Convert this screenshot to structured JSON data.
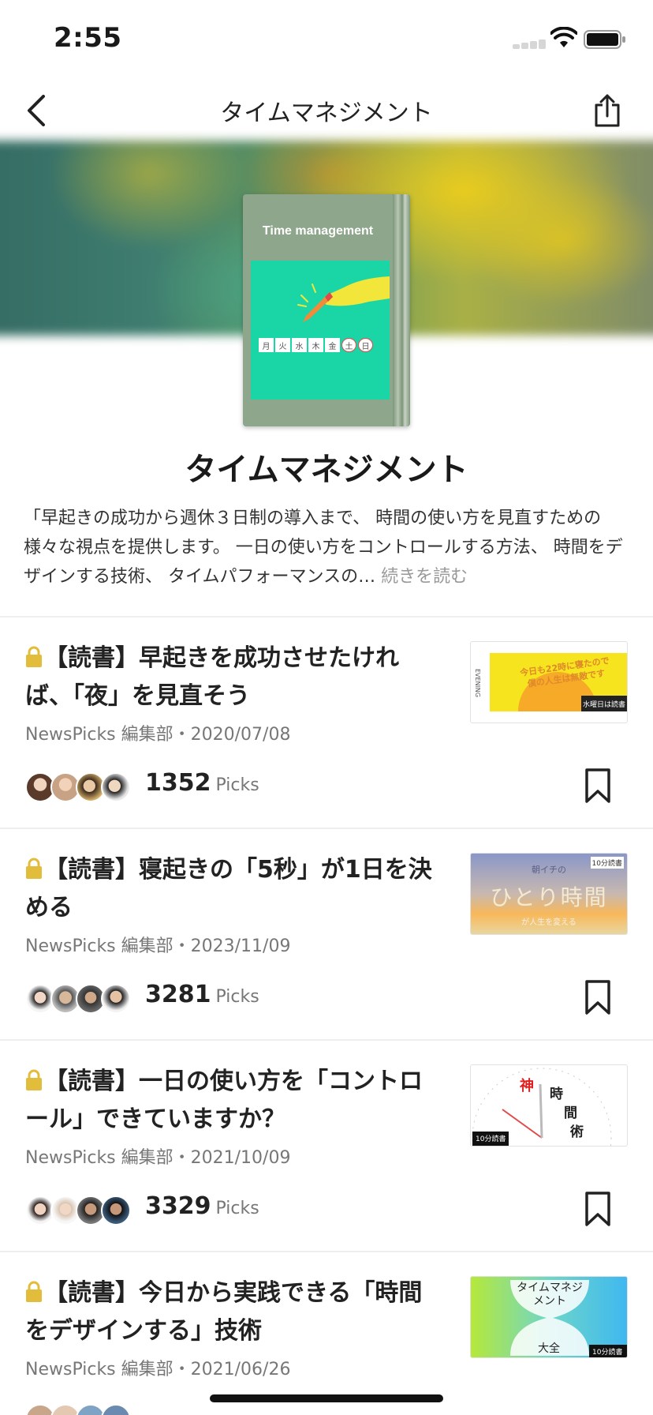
{
  "status_bar": {
    "time": "2:55"
  },
  "nav": {
    "title": "タイムマネジメント"
  },
  "hero": {
    "book_title": "Time management",
    "book_days": [
      "月",
      "火",
      "水",
      "木",
      "金",
      "土",
      "日"
    ]
  },
  "collection": {
    "title": "タイムマネジメント",
    "description": "「早起きの成功から週休３日制の導入まで、 時間の使い方を見直すための様々な視点を提供します。 一日の使い方をコントロールする方法、 時間をデザインする技術、 タイムパフォーマンスの…",
    "read_more": "続きを読む"
  },
  "articles": [
    {
      "title": "【読書】早起きを成功させたければ、「夜」を見直そう",
      "meta": "NewsPicks 編集部・2020/07/08",
      "picks": "1352",
      "picks_label": "Picks",
      "thumb_text": [
        "今日も22時に寝たので",
        "僕の人生は無敵です",
        "EVENING",
        "水曜日は読書"
      ]
    },
    {
      "title": "【読書】寝起きの「5秒」が1日を決める",
      "meta": "NewsPicks 編集部・2023/11/09",
      "picks": "3281",
      "picks_label": "Picks",
      "thumb_text": [
        "朝イチの",
        "ひとり時間",
        "が人生を変える",
        "10分読書"
      ]
    },
    {
      "title": "【読書】一日の使い方を「コントロール」できていますか？",
      "meta": "NewsPicks 編集部・2021/10/09",
      "picks": "3329",
      "picks_label": "Picks",
      "thumb_text": [
        "神",
        "時",
        "間",
        "術",
        "10分読書"
      ]
    },
    {
      "title": "【読書】今日から実践できる「時間をデザインする」技術",
      "meta": "NewsPicks 編集部・2021/06/26",
      "picks": "",
      "picks_label": "",
      "thumb_text": [
        "タイムマネジメント",
        "大全",
        "10分読書"
      ]
    }
  ],
  "colors": {
    "lock": "#e2bd3c",
    "divider": "#eeeeee",
    "hero_teal": "#1ad6a6",
    "book_green": "#8da68c"
  }
}
